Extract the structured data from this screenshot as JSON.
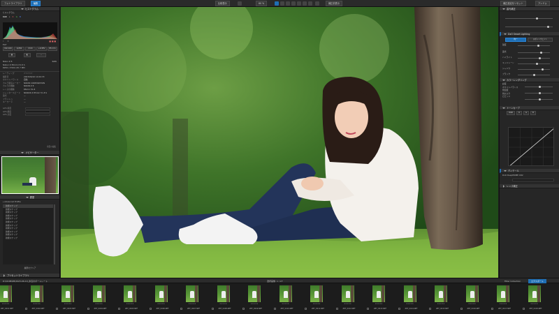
{
  "topbar": {
    "tab_library": "フォトライブラリ",
    "tab_edit": "編集",
    "compare": "比較表示",
    "zoom": "60 %",
    "before_after": "補正前表示",
    "workspace": "補正設定をリセット",
    "workspace2": "アンドゥ"
  },
  "left": {
    "histogram_title": "ヒストグラム",
    "histogram_sub": "ヒストグラム",
    "mode_buttons": [
      "RGB",
      "L",
      "R",
      "G",
      "B"
    ],
    "exif_label": "Exif",
    "exif_tabs": [
      "ISO 100",
      "1/250",
      "f/2.8",
      "+0.3EV",
      "85 mm"
    ],
    "info_rows": [
      {
        "k": "Nikon Z 8",
        "v": "",
        "rv": "RAW"
      },
      {
        "k": "Nikkor Z 85mm f/1.8 S",
        "v": "",
        "rv": ""
      },
      {
        "k": "8256 x 5504 (45.7 MP)",
        "v": "",
        "rv": ""
      }
    ],
    "meta_rows": [
      {
        "k": "レーティング",
        "v": "☆☆☆☆☆"
      },
      {
        "k": "撮影日",
        "v": "2023/06/10 14:04:33"
      },
      {
        "k": "ホワイトバランス",
        "v": "自動"
      },
      {
        "k": "カメラ製造メーカー",
        "v": "NIKON CORPORATION"
      },
      {
        "k": "カメラの機種",
        "v": "NIKON Z 8"
      },
      {
        "k": "レンズの機種",
        "v": "85mm f/1.8"
      },
      {
        "k": "シャッタースピード",
        "v": "NIKKOR Z 85mm f/1.8 S"
      },
      {
        "k": "露光",
        "v": "—"
      },
      {
        "k": "フラッシュ",
        "v": "—"
      },
      {
        "k": "キーワード",
        "v": "—"
      }
    ],
    "gps_rows": [
      {
        "k": "GPS 緯度",
        "v": ""
      },
      {
        "k": "GPS 経度",
        "v": ""
      },
      {
        "k": "GPS 高度",
        "v": ""
      }
    ],
    "edit_link": "項目の編集",
    "preview_title": "ナビゲーター",
    "history_title": "履歴",
    "history_items": [
      "Advanced Profile",
      "新規スナップ",
      "新規スナップ",
      "新規スナップ",
      "新規スナップ",
      "新規スナップ",
      "新規スナップ",
      "新規スナップ",
      "新規スナップ",
      "新規スナップ",
      "新規スナップ",
      "新規スナップ"
    ],
    "history_clear": "履歴をクリア",
    "footer": "プリセットライブラリ"
  },
  "right": {
    "section1": "露光補正",
    "section2": "DxO Smart Lighting",
    "btn_a": "均一",
    "btn_b": "スポットウェイト",
    "slider_labels": [
      "強度",
      "露光",
      "ハイライト",
      "ミッドトーン",
      "シャドウ",
      "ブラック"
    ],
    "section3": "カラーレンダリング",
    "sub_rows": [
      "彩度",
      "ホワイトバランス",
      "色温度",
      "色かぶり",
      "ビビッド"
    ],
    "curve_title": "トーンカーブ",
    "curve_tabs": [
      "RGB",
      "R",
      "G",
      "B"
    ],
    "footer_a": "ディテール",
    "footer_b": "DxO DeepPRIME XD2",
    "footer_c": "レンズ補正"
  },
  "filmbar": {
    "path": "D:\\DCIM\\Z8\\2023-06-10_水辺のポートレート",
    "count": "選択画像: 1 / 27",
    "filter": "Filter Collection",
    "export": "エクスポート"
  },
  "thumbs": [
    "Z8T_0001.NEF",
    "Z8T_0002.NEF",
    "Z8T_0003.NEF",
    "Z8T_0004.NEF",
    "Z8T_0005.NEF",
    "Z8T_0006.NEF",
    "Z8T_0007.NEF",
    "Z8T_0008.NEF",
    "Z8T_0009.NEF",
    "Z8T_0010.NEF",
    "Z8T_0011.NEF",
    "Z8T_0012.NEF",
    "Z8T_0013.NEF",
    "Z8T_0014.NEF",
    "Z8T_0015.NEF",
    "Z8T_0016.NEF",
    "Z8T_0017.NEF",
    "Z8T_0018.NEF"
  ],
  "colors": {
    "accent": "#1f6fb5",
    "panel": "#262626",
    "grass": "#6aa83a"
  }
}
